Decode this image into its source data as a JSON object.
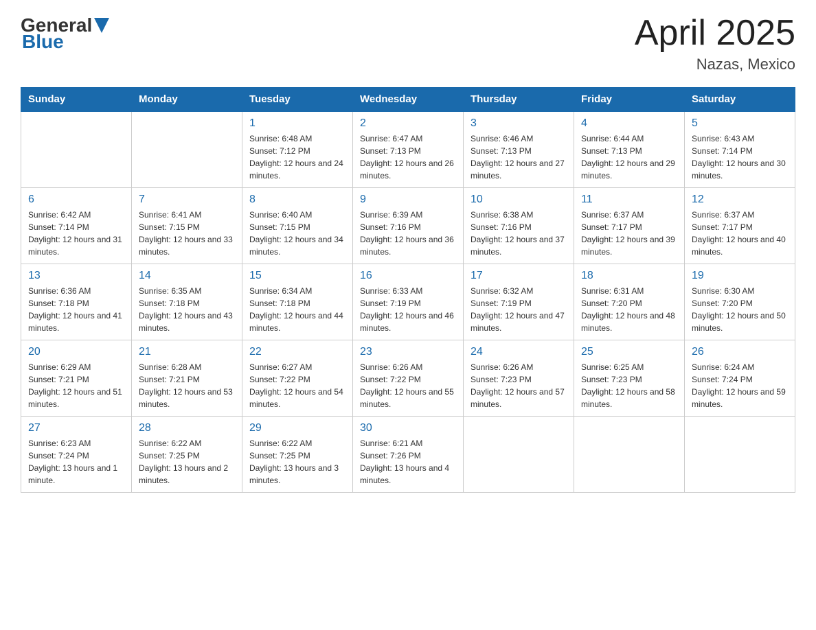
{
  "header": {
    "logo_general": "General",
    "logo_blue": "Blue",
    "title": "April 2025",
    "subtitle": "Nazas, Mexico"
  },
  "days_of_week": [
    "Sunday",
    "Monday",
    "Tuesday",
    "Wednesday",
    "Thursday",
    "Friday",
    "Saturday"
  ],
  "weeks": [
    [
      {
        "day": "",
        "sunrise": "",
        "sunset": "",
        "daylight": ""
      },
      {
        "day": "",
        "sunrise": "",
        "sunset": "",
        "daylight": ""
      },
      {
        "day": "1",
        "sunrise": "Sunrise: 6:48 AM",
        "sunset": "Sunset: 7:12 PM",
        "daylight": "Daylight: 12 hours and 24 minutes."
      },
      {
        "day": "2",
        "sunrise": "Sunrise: 6:47 AM",
        "sunset": "Sunset: 7:13 PM",
        "daylight": "Daylight: 12 hours and 26 minutes."
      },
      {
        "day": "3",
        "sunrise": "Sunrise: 6:46 AM",
        "sunset": "Sunset: 7:13 PM",
        "daylight": "Daylight: 12 hours and 27 minutes."
      },
      {
        "day": "4",
        "sunrise": "Sunrise: 6:44 AM",
        "sunset": "Sunset: 7:13 PM",
        "daylight": "Daylight: 12 hours and 29 minutes."
      },
      {
        "day": "5",
        "sunrise": "Sunrise: 6:43 AM",
        "sunset": "Sunset: 7:14 PM",
        "daylight": "Daylight: 12 hours and 30 minutes."
      }
    ],
    [
      {
        "day": "6",
        "sunrise": "Sunrise: 6:42 AM",
        "sunset": "Sunset: 7:14 PM",
        "daylight": "Daylight: 12 hours and 31 minutes."
      },
      {
        "day": "7",
        "sunrise": "Sunrise: 6:41 AM",
        "sunset": "Sunset: 7:15 PM",
        "daylight": "Daylight: 12 hours and 33 minutes."
      },
      {
        "day": "8",
        "sunrise": "Sunrise: 6:40 AM",
        "sunset": "Sunset: 7:15 PM",
        "daylight": "Daylight: 12 hours and 34 minutes."
      },
      {
        "day": "9",
        "sunrise": "Sunrise: 6:39 AM",
        "sunset": "Sunset: 7:16 PM",
        "daylight": "Daylight: 12 hours and 36 minutes."
      },
      {
        "day": "10",
        "sunrise": "Sunrise: 6:38 AM",
        "sunset": "Sunset: 7:16 PM",
        "daylight": "Daylight: 12 hours and 37 minutes."
      },
      {
        "day": "11",
        "sunrise": "Sunrise: 6:37 AM",
        "sunset": "Sunset: 7:17 PM",
        "daylight": "Daylight: 12 hours and 39 minutes."
      },
      {
        "day": "12",
        "sunrise": "Sunrise: 6:37 AM",
        "sunset": "Sunset: 7:17 PM",
        "daylight": "Daylight: 12 hours and 40 minutes."
      }
    ],
    [
      {
        "day": "13",
        "sunrise": "Sunrise: 6:36 AM",
        "sunset": "Sunset: 7:18 PM",
        "daylight": "Daylight: 12 hours and 41 minutes."
      },
      {
        "day": "14",
        "sunrise": "Sunrise: 6:35 AM",
        "sunset": "Sunset: 7:18 PM",
        "daylight": "Daylight: 12 hours and 43 minutes."
      },
      {
        "day": "15",
        "sunrise": "Sunrise: 6:34 AM",
        "sunset": "Sunset: 7:18 PM",
        "daylight": "Daylight: 12 hours and 44 minutes."
      },
      {
        "day": "16",
        "sunrise": "Sunrise: 6:33 AM",
        "sunset": "Sunset: 7:19 PM",
        "daylight": "Daylight: 12 hours and 46 minutes."
      },
      {
        "day": "17",
        "sunrise": "Sunrise: 6:32 AM",
        "sunset": "Sunset: 7:19 PM",
        "daylight": "Daylight: 12 hours and 47 minutes."
      },
      {
        "day": "18",
        "sunrise": "Sunrise: 6:31 AM",
        "sunset": "Sunset: 7:20 PM",
        "daylight": "Daylight: 12 hours and 48 minutes."
      },
      {
        "day": "19",
        "sunrise": "Sunrise: 6:30 AM",
        "sunset": "Sunset: 7:20 PM",
        "daylight": "Daylight: 12 hours and 50 minutes."
      }
    ],
    [
      {
        "day": "20",
        "sunrise": "Sunrise: 6:29 AM",
        "sunset": "Sunset: 7:21 PM",
        "daylight": "Daylight: 12 hours and 51 minutes."
      },
      {
        "day": "21",
        "sunrise": "Sunrise: 6:28 AM",
        "sunset": "Sunset: 7:21 PM",
        "daylight": "Daylight: 12 hours and 53 minutes."
      },
      {
        "day": "22",
        "sunrise": "Sunrise: 6:27 AM",
        "sunset": "Sunset: 7:22 PM",
        "daylight": "Daylight: 12 hours and 54 minutes."
      },
      {
        "day": "23",
        "sunrise": "Sunrise: 6:26 AM",
        "sunset": "Sunset: 7:22 PM",
        "daylight": "Daylight: 12 hours and 55 minutes."
      },
      {
        "day": "24",
        "sunrise": "Sunrise: 6:26 AM",
        "sunset": "Sunset: 7:23 PM",
        "daylight": "Daylight: 12 hours and 57 minutes."
      },
      {
        "day": "25",
        "sunrise": "Sunrise: 6:25 AM",
        "sunset": "Sunset: 7:23 PM",
        "daylight": "Daylight: 12 hours and 58 minutes."
      },
      {
        "day": "26",
        "sunrise": "Sunrise: 6:24 AM",
        "sunset": "Sunset: 7:24 PM",
        "daylight": "Daylight: 12 hours and 59 minutes."
      }
    ],
    [
      {
        "day": "27",
        "sunrise": "Sunrise: 6:23 AM",
        "sunset": "Sunset: 7:24 PM",
        "daylight": "Daylight: 13 hours and 1 minute."
      },
      {
        "day": "28",
        "sunrise": "Sunrise: 6:22 AM",
        "sunset": "Sunset: 7:25 PM",
        "daylight": "Daylight: 13 hours and 2 minutes."
      },
      {
        "day": "29",
        "sunrise": "Sunrise: 6:22 AM",
        "sunset": "Sunset: 7:25 PM",
        "daylight": "Daylight: 13 hours and 3 minutes."
      },
      {
        "day": "30",
        "sunrise": "Sunrise: 6:21 AM",
        "sunset": "Sunset: 7:26 PM",
        "daylight": "Daylight: 13 hours and 4 minutes."
      },
      {
        "day": "",
        "sunrise": "",
        "sunset": "",
        "daylight": ""
      },
      {
        "day": "",
        "sunrise": "",
        "sunset": "",
        "daylight": ""
      },
      {
        "day": "",
        "sunrise": "",
        "sunset": "",
        "daylight": ""
      }
    ]
  ]
}
